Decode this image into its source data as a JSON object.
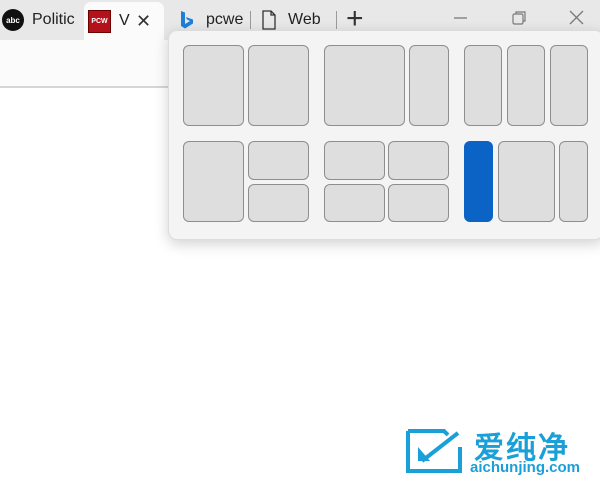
{
  "tabs": [
    {
      "label": "Politic",
      "favicon": "abc",
      "active": false
    },
    {
      "label": "V",
      "favicon": "PCW",
      "active": true
    },
    {
      "label": "pcwel",
      "favicon": "bing-icon",
      "active": false
    },
    {
      "label": "Web",
      "favicon": "page-icon",
      "active": false
    }
  ],
  "new_tab_glyph": "+",
  "close_glyph": "✕",
  "snap_layouts": {
    "selected_layout": 6,
    "selected_zone": 1,
    "accent_color": "#0b63c6"
  },
  "watermark": {
    "name": "爱纯净",
    "url": "aichunjing.com"
  }
}
